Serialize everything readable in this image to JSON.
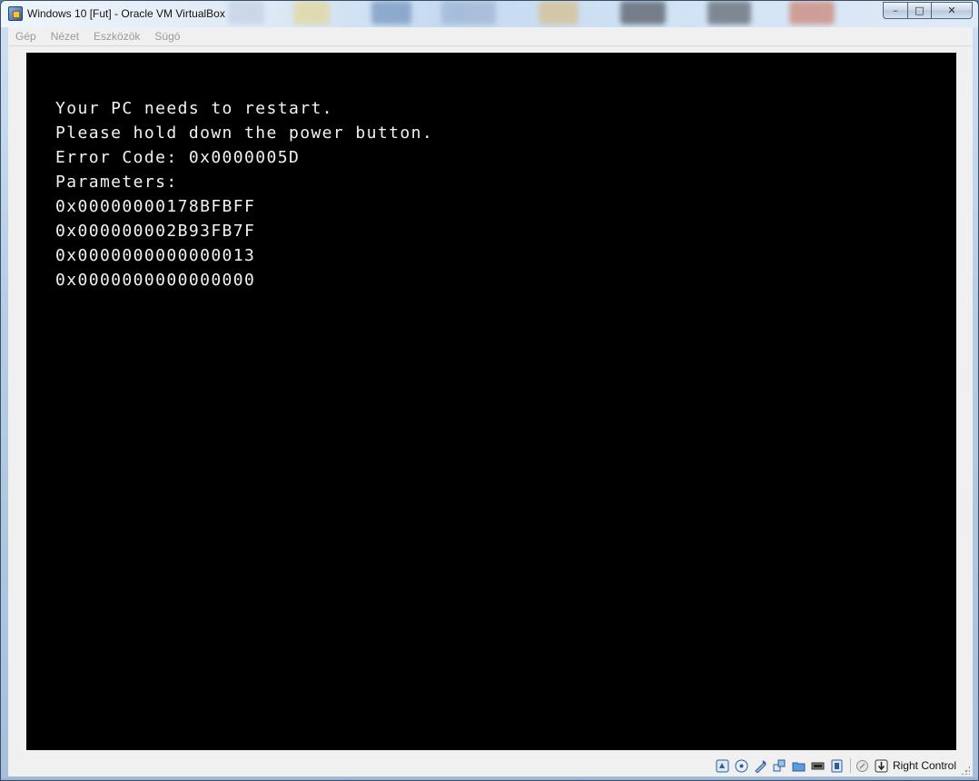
{
  "window": {
    "title": "Windows 10 [Fut] - Oracle VM VirtualBox",
    "controls": {
      "minimize": "–",
      "maximize": "□",
      "close": "✕"
    }
  },
  "menubar": {
    "items": [
      {
        "label": "Gép"
      },
      {
        "label": "Nézet"
      },
      {
        "label": "Eszközök"
      },
      {
        "label": "Súgó"
      }
    ]
  },
  "vm_screen": {
    "lines": [
      "Your PC needs to restart.",
      "Please hold down the power button.",
      "Error Code: 0x0000005D",
      "Parameters:",
      "0x00000000178BFBFF",
      "0x000000002B93FB7F",
      "0x0000000000000013",
      "0x0000000000000000"
    ],
    "background": "#000000",
    "text_color": "#f2f2f2"
  },
  "statusbar": {
    "icons": [
      "hard-disk-icon",
      "optical-drive-icon",
      "audio-icon",
      "network-icon",
      "shared-folders-icon",
      "display-icon",
      "video-capture-icon",
      "mouse-integration-icon",
      "host-key-icon"
    ],
    "host_key_label": "Right Control"
  }
}
